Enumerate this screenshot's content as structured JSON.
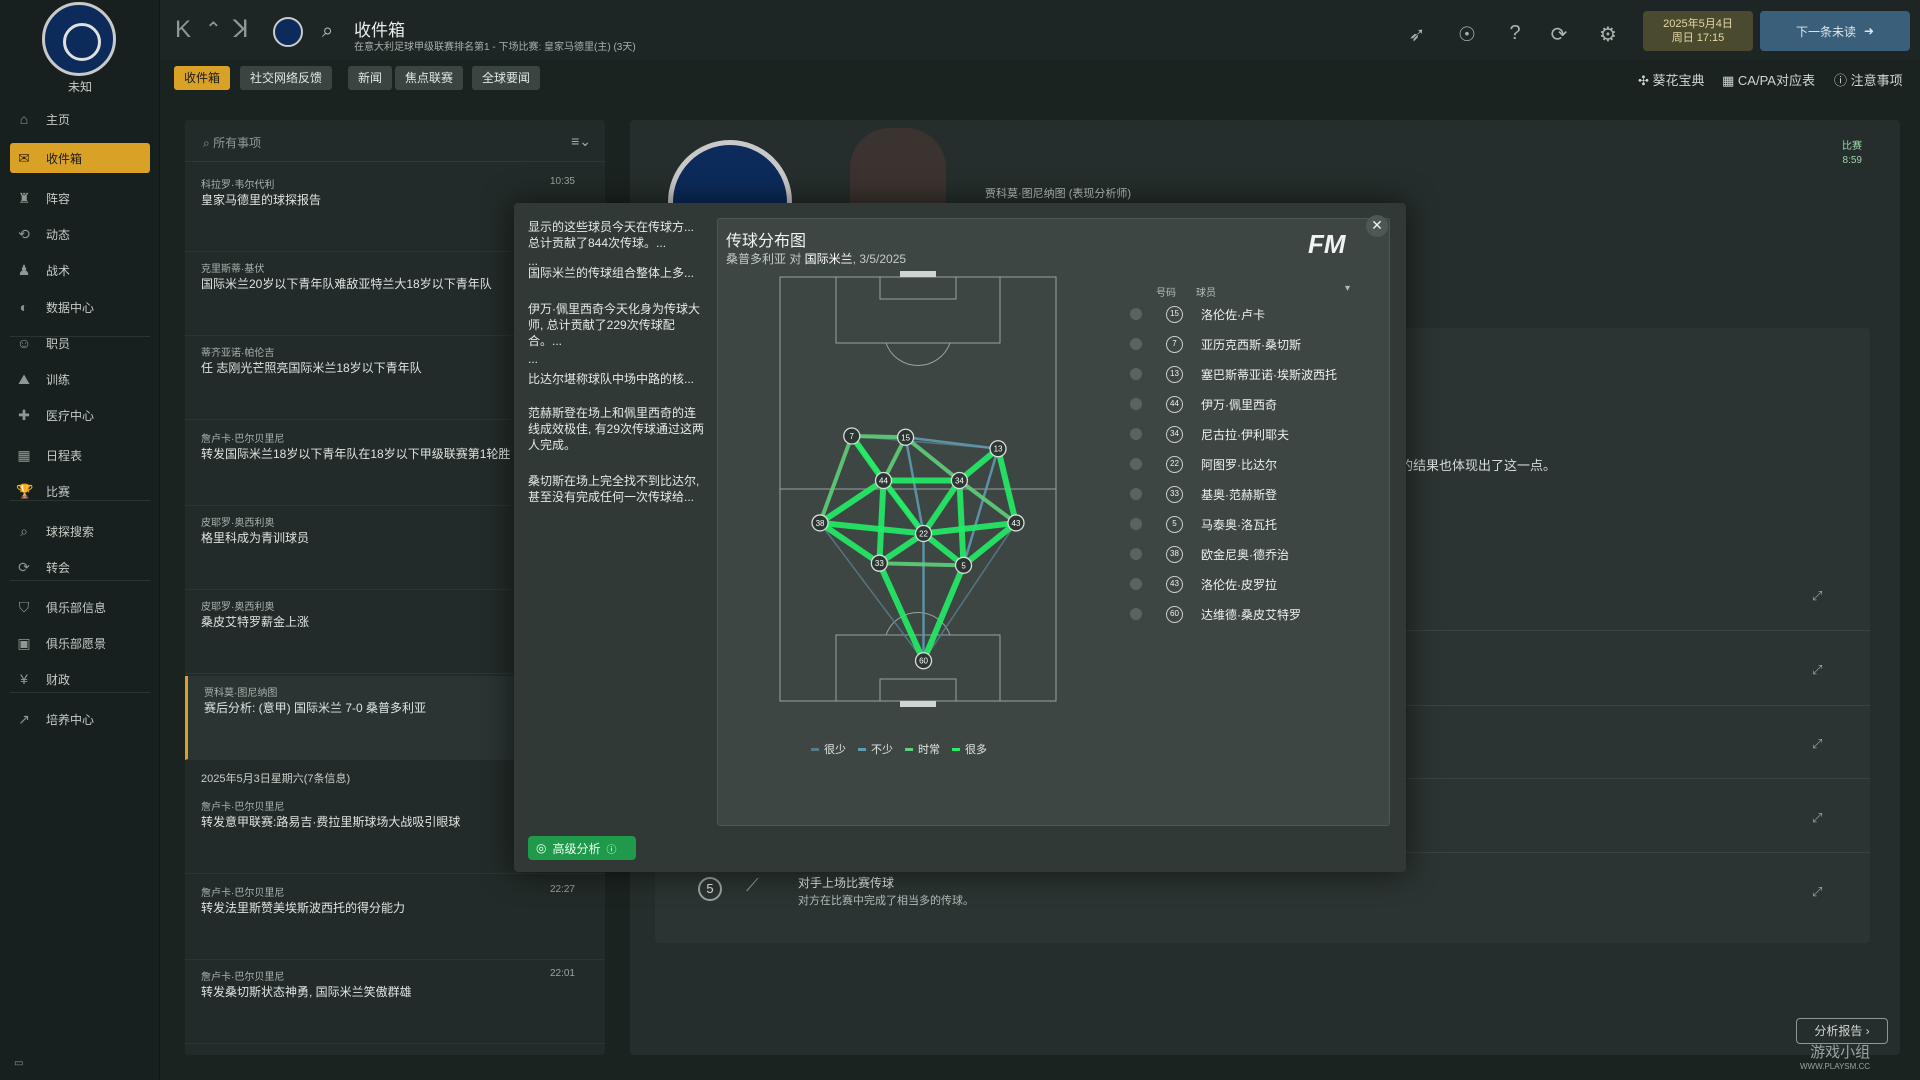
{
  "sidebar": {
    "club_name": "未知",
    "items": [
      {
        "label": "主页",
        "icon": "home-icon"
      },
      {
        "label": "收件箱",
        "icon": "inbox-icon",
        "active": true
      },
      {
        "label": "阵容",
        "icon": "squad-icon"
      },
      {
        "label": "动态",
        "icon": "dynamics-icon"
      },
      {
        "label": "战术",
        "icon": "tactics-icon"
      },
      {
        "label": "数据中心",
        "icon": "data-hub-icon"
      },
      {
        "label": "职员",
        "icon": "staff-icon"
      },
      {
        "label": "训练",
        "icon": "training-icon"
      },
      {
        "label": "医疗中心",
        "icon": "medical-icon"
      },
      {
        "label": "日程表",
        "icon": "schedule-icon"
      },
      {
        "label": "比赛",
        "icon": "trophy-icon"
      },
      {
        "label": "球探搜索",
        "icon": "scouting-icon"
      },
      {
        "label": "转会",
        "icon": "transfer-icon"
      },
      {
        "label": "俱乐部信息",
        "icon": "club-info-icon"
      },
      {
        "label": "俱乐部愿景",
        "icon": "club-vision-icon"
      },
      {
        "label": "财政",
        "icon": "finance-icon"
      },
      {
        "label": "培养中心",
        "icon": "development-icon"
      }
    ]
  },
  "topbar": {
    "title": "收件箱",
    "subtitle": "在意大利足球甲级联赛排名第1 - 下场比赛: 皇家马德里(主) (3天)",
    "date_line1": "2025年5月4日",
    "date_line2": "周日 17:15",
    "next_label": "下一条未读"
  },
  "tabs": [
    "收件箱",
    "社交网络反馈",
    "新闻",
    "焦点联赛",
    "全球要闻"
  ],
  "right_links": [
    "葵花宝典",
    "CA/PA对应表",
    "注意事项"
  ],
  "inbox": {
    "search_placeholder": "所有事项",
    "items": [
      {
        "from": "科拉罗·韦尔代利",
        "subject": "皇家马德里的球探报告",
        "time": "10:35"
      },
      {
        "from": "克里斯蒂·基伏",
        "subject": "国际米兰20岁以下青年队难敌亚特兰大18岁以下青年队",
        "time": ""
      },
      {
        "from": "蒂齐亚诺·帕伦吉",
        "subject": "任 志刚光芒照亮国际米兰18岁以下青年队",
        "time": ""
      },
      {
        "from": "詹卢卡·巴尔贝里尼",
        "subject": "转发国际米兰18岁以下青年队在18岁以下甲级联赛第1轮胜",
        "time": ""
      },
      {
        "from": "皮耶罗·奥西利奥",
        "subject": "格里科成为青训球员",
        "time": ""
      },
      {
        "from": "皮耶罗·奥西利奥",
        "subject": "桑皮艾特罗薪金上涨",
        "time": ""
      },
      {
        "from": "贾科莫·图尼纳图",
        "subject": "赛后分析: (意甲) 国际米兰 7-0 桑普多利亚",
        "time": ""
      }
    ],
    "date_header": "2025年5月3日星期六(7条信息)",
    "items2": [
      {
        "from": "詹卢卡·巴尔贝里尼",
        "subject": "转发意甲联赛:路易吉·费拉里斯球场大战吸引眼球",
        "time": ""
      },
      {
        "from": "詹卢卡·巴尔贝里尼",
        "subject": "转发法里斯赞美埃斯波西托的得分能力",
        "time": "22:27"
      },
      {
        "from": "詹卢卡·巴尔贝里尼",
        "subject": "转发桑切斯状态神勇, 国际米兰笑傲群雄",
        "time": "22:01"
      }
    ]
  },
  "background": {
    "analyst": "贾科莫·图尼纳图 (表现分析师)",
    "match_label": "比赛",
    "match_time": "8:59",
    "text": "的结果也体现出了这一点。",
    "row5_num": "5",
    "row5_title": "对手上场比赛传球",
    "row5_desc": "对方在比赛中完成了相当多的传球。",
    "report_btn": "分析报告 ›",
    "watermark": "游戏小组",
    "watermark_url": "WWW.PLAYSM.CC"
  },
  "modal": {
    "insights": [
      "显示的这些球员今天在传球方... 总计贡献了844次传球。...",
      "...",
      "国际米兰的传球组合整体上多...",
      "伊万·佩里西奇今天化身为传球大师, 总计贡献了229次传球配合。...",
      "...",
      "比达尔堪称球队中场中路的核...",
      "范赫斯登在场上和佩里西奇的连线成效极佳, 有29次传球通过这两人完成。",
      "桑切斯在场上完全找不到比达尔, 甚至没有完成任何一次传球给..."
    ],
    "advanced_btn": "高级分析",
    "chart_title": "传球分布图",
    "chart_subtitle_a": "桑普多利亚 对 ",
    "chart_subtitle_b": "国际米兰",
    "chart_subtitle_c": ", 3/5/2025",
    "fm_logo": "FM",
    "col_num": "号码",
    "col_player": "球员",
    "legend": [
      "很少",
      "不少",
      "时常",
      "很多"
    ]
  },
  "chart_data": {
    "type": "pass-network",
    "title": "传球分布图",
    "subtitle": "桑普多利亚 对 国际米兰, 3/5/2025",
    "legend_levels": [
      "很少",
      "不少",
      "时常",
      "很多"
    ],
    "colors": {
      "很少": "#5a7a86",
      "不少": "#5f9ab0",
      "时常": "#5fd07a",
      "很多": "#22ee66"
    },
    "players": [
      {
        "num": "15",
        "name": "洛伦佐·卢卡"
      },
      {
        "num": "7",
        "name": "亚历克西斯·桑切斯"
      },
      {
        "num": "13",
        "name": "塞巴斯蒂亚诺·埃斯波西托"
      },
      {
        "num": "44",
        "name": "伊万·佩里西奇"
      },
      {
        "num": "34",
        "name": "尼古拉·伊利耶夫"
      },
      {
        "num": "22",
        "name": "阿图罗·比达尔"
      },
      {
        "num": "33",
        "name": "基奥·范赫斯登"
      },
      {
        "num": "5",
        "name": "马泰奥·洛瓦托"
      },
      {
        "num": "38",
        "name": "欧金尼奥·德乔治"
      },
      {
        "num": "43",
        "name": "洛伦佐·皮罗拉"
      },
      {
        "num": "60",
        "name": "达维德·桑皮艾特罗"
      }
    ],
    "positions_units": "pitch fraction (x across, y down, attacking upward)",
    "positions": {
      "7": [
        0.26,
        0.375
      ],
      "15": [
        0.455,
        0.378
      ],
      "13": [
        0.79,
        0.405
      ],
      "44": [
        0.375,
        0.48
      ],
      "34": [
        0.65,
        0.48
      ],
      "38": [
        0.145,
        0.58
      ],
      "43": [
        0.855,
        0.58
      ],
      "22": [
        0.52,
        0.605
      ],
      "33": [
        0.36,
        0.675
      ],
      "5": [
        0.665,
        0.68
      ],
      "60": [
        0.52,
        0.905
      ]
    },
    "links": [
      {
        "a": "60",
        "b": "33",
        "level": "很多"
      },
      {
        "a": "60",
        "b": "5",
        "level": "很多"
      },
      {
        "a": "33",
        "b": "38",
        "level": "很多"
      },
      {
        "a": "5",
        "b": "43",
        "level": "很多"
      },
      {
        "a": "44",
        "b": "38",
        "level": "很多"
      },
      {
        "a": "44",
        "b": "7",
        "level": "很多"
      },
      {
        "a": "44",
        "b": "15",
        "level": "时常"
      },
      {
        "a": "44",
        "b": "34",
        "level": "很多"
      },
      {
        "a": "44",
        "b": "22",
        "level": "很多"
      },
      {
        "a": "44",
        "b": "33",
        "level": "很多"
      },
      {
        "a": "34",
        "b": "13",
        "level": "很多"
      },
      {
        "a": "34",
        "b": "22",
        "level": "很多"
      },
      {
        "a": "34",
        "b": "5",
        "level": "很多"
      },
      {
        "a": "34",
        "b": "15",
        "level": "时常"
      },
      {
        "a": "43",
        "b": "13",
        "level": "很多"
      },
      {
        "a": "43",
        "b": "34",
        "level": "时常"
      },
      {
        "a": "22",
        "b": "33",
        "level": "很多"
      },
      {
        "a": "22",
        "b": "5",
        "level": "很多"
      },
      {
        "a": "7",
        "b": "15",
        "level": "时常"
      },
      {
        "a": "15",
        "b": "13",
        "level": "不少"
      },
      {
        "a": "7",
        "b": "38",
        "level": "时常"
      },
      {
        "a": "7",
        "b": "22",
        "level": "时常"
      },
      {
        "a": "15",
        "b": "22",
        "level": "不少"
      },
      {
        "a": "38",
        "b": "22",
        "level": "很多"
      },
      {
        "a": "43",
        "b": "22",
        "level": "很多"
      },
      {
        "a": "60",
        "b": "22",
        "level": "不少"
      },
      {
        "a": "33",
        "b": "5",
        "level": "时常"
      },
      {
        "a": "13",
        "b": "5",
        "level": "不少"
      },
      {
        "a": "7",
        "b": "13",
        "level": "很少"
      },
      {
        "a": "38",
        "b": "60",
        "level": "很少"
      },
      {
        "a": "43",
        "b": "60",
        "level": "很少"
      }
    ]
  }
}
